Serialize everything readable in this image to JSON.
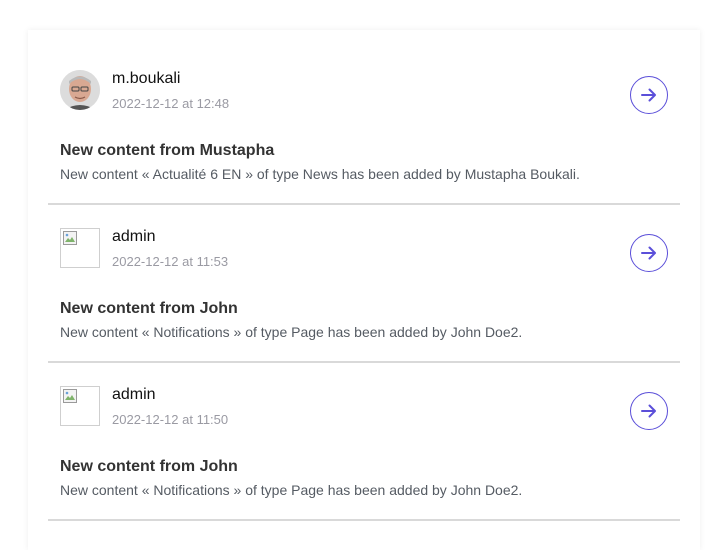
{
  "accent_color": "#5b4fd9",
  "notifications": [
    {
      "avatar": "user-photo",
      "username": "m.boukali",
      "timestamp": "2022-12-12 at 12:48",
      "title": "New content from Mustapha",
      "description": "New content « Actualité 6 EN » of type News has been added by Mustapha Boukali.",
      "action_icon": "arrow-right-circle-icon"
    },
    {
      "avatar": "broken-image",
      "username": "admin",
      "timestamp": "2022-12-12 at 11:53",
      "title": "New content from John",
      "description": "New content « Notifications » of type Page has been added by John Doe2.",
      "action_icon": "arrow-right-circle-icon"
    },
    {
      "avatar": "broken-image",
      "username": "admin",
      "timestamp": "2022-12-12 at 11:50",
      "title": "New content from John",
      "description": "New content « Notifications » of type Page has been added by John Doe2.",
      "action_icon": "arrow-right-circle-icon"
    }
  ]
}
